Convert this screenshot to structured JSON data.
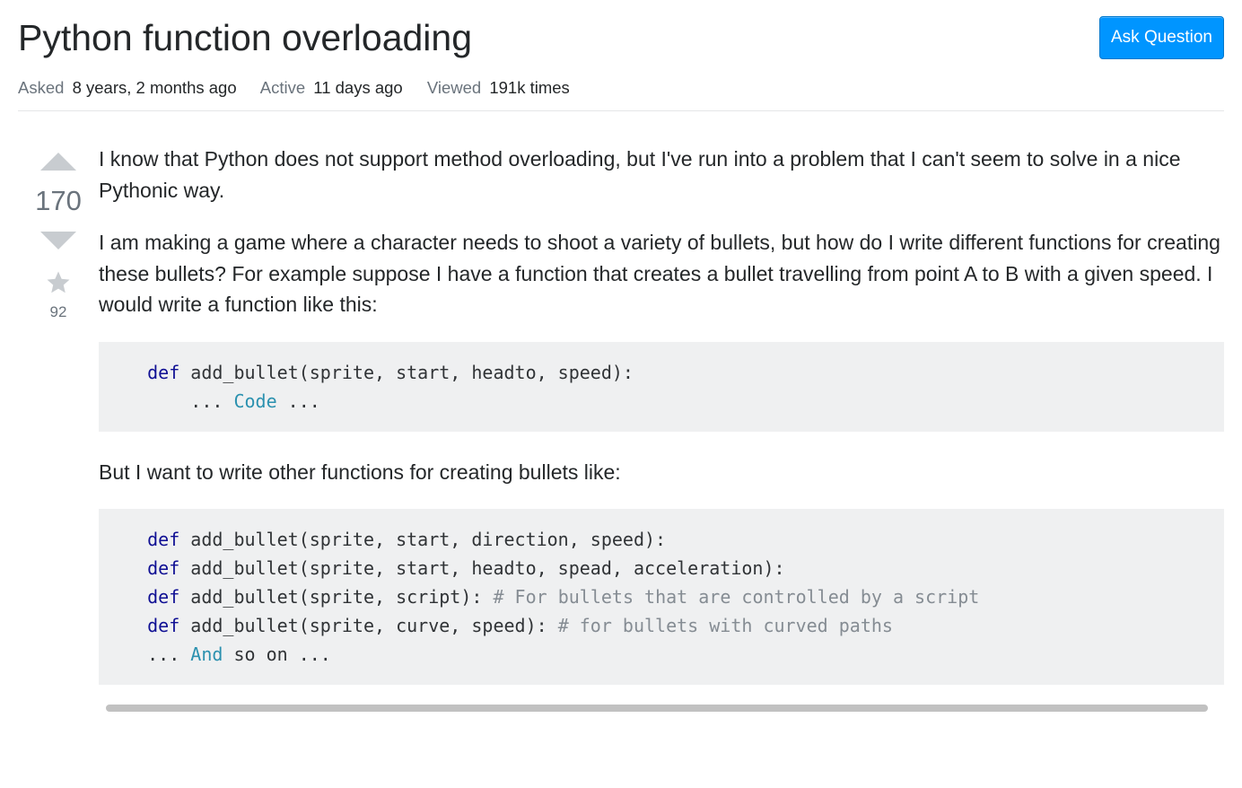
{
  "header": {
    "title": "Python function overloading",
    "ask_button": "Ask Question"
  },
  "meta": {
    "asked_label": "Asked",
    "asked_value": "8 years, 2 months ago",
    "active_label": "Active",
    "active_value": "11 days ago",
    "viewed_label": "Viewed",
    "viewed_value": "191k times"
  },
  "votes": {
    "score": "170",
    "favorites": "92"
  },
  "body": {
    "para1": "I know that Python does not support method overloading, but I've run into a problem that I can't seem to solve in a nice Pythonic way.",
    "para2": "I am making a game where a character needs to shoot a variety of bullets, but how do I write different functions for creating these bullets? For example suppose I have a function that creates a bullet travelling from point A to B with a given speed. I would write a function like this:",
    "para3": "But I want to write other functions for creating bullets like:"
  },
  "code1": {
    "kw1": "def",
    "sig": " add_bullet(sprite, start, headto, speed):",
    "indent": "    ... ",
    "cls": "Code",
    "rest": " ..."
  },
  "code2": {
    "l1_kw": "def",
    "l1_rest": " add_bullet(sprite, start, direction, speed):",
    "l2_kw": "def",
    "l2_rest": " add_bullet(sprite, start, headto, spead, acceleration):",
    "l3_kw": "def",
    "l3_rest": " add_bullet(sprite, script): ",
    "l3_cmt": "# For bullets that are controlled by a script",
    "l4_kw": "def",
    "l4_rest": " add_bullet(sprite, curve, speed): ",
    "l4_cmt": "# for bullets with curved paths",
    "l5_pre": "... ",
    "l5_cls": "And",
    "l5_post": " so on ..."
  }
}
